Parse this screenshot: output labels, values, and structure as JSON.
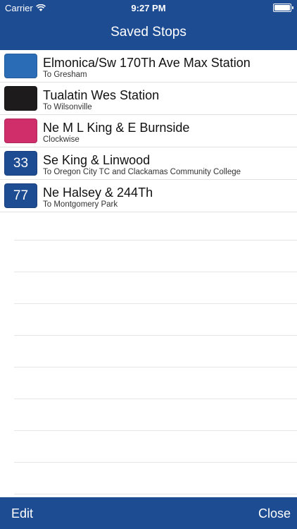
{
  "status_bar": {
    "carrier": "Carrier",
    "time": "9:27 PM",
    "wifi_icon": "wifi-icon",
    "battery_icon": "battery-icon"
  },
  "nav": {
    "title": "Saved Stops",
    "background": "#1e4c93"
  },
  "stops": [
    {
      "badge_text": "",
      "badge_color": "#2b6cb6",
      "name": "Elmonica/Sw 170Th Ave Max Station",
      "direction": "To Gresham"
    },
    {
      "badge_text": "",
      "badge_color": "#1d1b1b",
      "name": "Tualatin Wes Station",
      "direction": "To Wilsonville"
    },
    {
      "badge_text": "",
      "badge_color": "#cf2e6a",
      "name": "Ne M L King & E Burnside",
      "direction": "Clockwise"
    },
    {
      "badge_text": "33",
      "badge_color": "#1e4c93",
      "name": "Se King & Linwood",
      "direction": "To Oregon City TC and Clackamas Community College"
    },
    {
      "badge_text": "77",
      "badge_color": "#1e4c93",
      "name": "Ne Halsey & 244Th",
      "direction": "To Montgomery Park"
    }
  ],
  "toolbar": {
    "edit_label": "Edit",
    "close_label": "Close"
  }
}
